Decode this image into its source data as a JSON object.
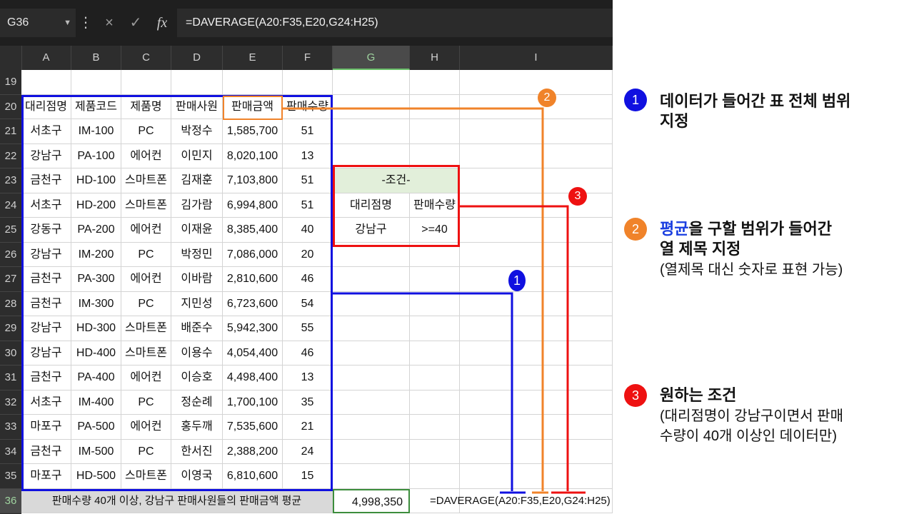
{
  "formula_bar": {
    "name_box": "G36",
    "cancel_icon": "×",
    "enter_icon": "✓",
    "fx_icon": "fx",
    "formula": "=DAVERAGE(A20:F35,E20,G24:H25)"
  },
  "columns": [
    "A",
    "B",
    "C",
    "D",
    "E",
    "F",
    "G",
    "H",
    "I"
  ],
  "rows": [
    "19",
    "20",
    "21",
    "22",
    "23",
    "24",
    "25",
    "26",
    "27",
    "28",
    "29",
    "30",
    "31",
    "32",
    "33",
    "34",
    "35",
    "36"
  ],
  "table": {
    "headers": [
      "대리점명",
      "제품코드",
      "제품명",
      "판매사원",
      "판매금액",
      "판매수량"
    ],
    "records": [
      [
        "서초구",
        "IM-100",
        "PC",
        "박정수",
        "1,585,700",
        "51"
      ],
      [
        "강남구",
        "PA-100",
        "에어컨",
        "이민지",
        "8,020,100",
        "13"
      ],
      [
        "금천구",
        "HD-100",
        "스마트폰",
        "김재훈",
        "7,103,800",
        "51"
      ],
      [
        "서초구",
        "HD-200",
        "스마트폰",
        "김가람",
        "6,994,800",
        "51"
      ],
      [
        "강동구",
        "PA-200",
        "에어컨",
        "이재윤",
        "8,385,400",
        "40"
      ],
      [
        "강남구",
        "IM-200",
        "PC",
        "박정민",
        "7,086,000",
        "20"
      ],
      [
        "금천구",
        "PA-300",
        "에어컨",
        "이바람",
        "2,810,600",
        "46"
      ],
      [
        "금천구",
        "IM-300",
        "PC",
        "지민성",
        "6,723,600",
        "54"
      ],
      [
        "강남구",
        "HD-300",
        "스마트폰",
        "배준수",
        "5,942,300",
        "55"
      ],
      [
        "강남구",
        "HD-400",
        "스마트폰",
        "이용수",
        "4,054,400",
        "46"
      ],
      [
        "금천구",
        "PA-400",
        "에어컨",
        "이승호",
        "4,498,400",
        "13"
      ],
      [
        "서초구",
        "IM-400",
        "PC",
        "정순례",
        "1,700,100",
        "35"
      ],
      [
        "마포구",
        "PA-500",
        "에어컨",
        "홍두깨",
        "7,535,600",
        "21"
      ],
      [
        "금천구",
        "IM-500",
        "PC",
        "한서진",
        "2,388,200",
        "24"
      ],
      [
        "마포구",
        "HD-500",
        "스마트폰",
        "이영국",
        "6,810,600",
        "15"
      ]
    ]
  },
  "criteria": {
    "title": "-조건-",
    "headers": [
      "대리점명",
      "판매수량"
    ],
    "values": [
      "강남구",
      ">=40"
    ]
  },
  "result_row": {
    "label": "판매수량 40개 이상, 강남구 판매사원들의 판매금액 평균",
    "value": "4,998,350",
    "formula": "=DAVERAGE(A20:F35,E20,G24:H25)"
  },
  "annotations": {
    "colors": {
      "range": "#1010e0",
      "field": "#f0832a",
      "criteria": "#ee1111"
    },
    "note1": {
      "badge": "1",
      "line1": "데이터가 들어간 표 전체 범위",
      "line2": "지정"
    },
    "note2": {
      "badge": "2",
      "hl": "평균",
      "line1_rest": "을 구할 범위가 들어간",
      "line2": "열 제목 지정",
      "sub": "(열제목 대신 숫자로 표현 가능)"
    },
    "note3": {
      "badge": "3",
      "line1": "원하는 조건",
      "sub1": "(대리점명이 강남구이면서 판매",
      "sub2": "수량이 40개 이상인 데이터만)"
    }
  }
}
